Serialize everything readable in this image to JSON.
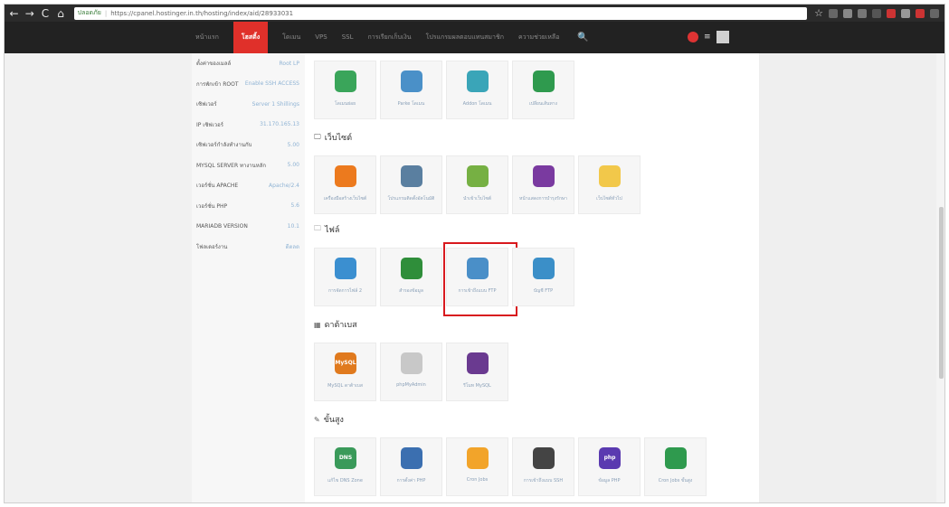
{
  "browser": {
    "back": "←",
    "forward": "→",
    "reload": "C",
    "home": "⌂",
    "lock": "🔒",
    "secure_label": "ปลอดภัย",
    "url": "https://cpanel.hostinger.in.th/hosting/index/aid/28933031",
    "star": "☆"
  },
  "topnav": {
    "items": [
      "หน้าแรก",
      "โฮสติ้ง",
      "โดเมน",
      "VPS",
      "SSL",
      "การเรียกเก็บเงิน",
      "โปรแกรมผลตอบแทนสมาชิก",
      "ความช่วยเหลือ"
    ],
    "active_index": 1,
    "search_icon": "🔍",
    "menu_icon": "≡"
  },
  "sidebar": {
    "items": [
      {
        "label": "ตั้งค่าของเมลล์",
        "value": "Root LP"
      },
      {
        "label": "การพักเข้า ROOT",
        "value": "Enable SSH ACCESS"
      },
      {
        "label": "เซิฟเวอร์",
        "value": "Server 1 Shillings"
      },
      {
        "label": "IP เซิฟเวอร์",
        "value": "31.170.165.13"
      },
      {
        "label": "เซิฟเวอร์กำลังทำงานกับ",
        "value": "5.00"
      },
      {
        "label": "MYSQL SERVER ทางานหลัก",
        "value": "5.00"
      },
      {
        "label": "เวอร์ชั่น APACHE",
        "value": "Apache/2.4"
      },
      {
        "label": "เวอร์ชั่น PHP",
        "value": "5.6"
      },
      {
        "label": "MARIADB VERSION",
        "value": "10.1"
      },
      {
        "label": "โฟลเดอร์งาน",
        "value": "ดีตลด"
      }
    ]
  },
  "sections": {
    "domains": {
      "tiles": [
        {
          "label": "โดเมนย่อย",
          "icon": "subdomain-icon",
          "color": "#3aa55a"
        },
        {
          "label": "Parke โดเมน",
          "icon": "parked-domain-icon",
          "color": "#4a90c8"
        },
        {
          "label": "Addon โดเมน",
          "icon": "addon-domain-icon",
          "color": "#3aa5b8"
        },
        {
          "label": "เปลี่ยนเส้นทาง",
          "icon": "redirect-icon",
          "color": "#2f9a4e"
        }
      ]
    },
    "website": {
      "title": "เว็บไซต์",
      "icon": "🖵",
      "tiles": [
        {
          "label": "เครื่องมือสร้างเว็บไซต์",
          "icon": "website-builder-icon",
          "color": "#ec7a1e"
        },
        {
          "label": "โปรแกรมติดตั้งอัตโนมัติ",
          "icon": "auto-installer-icon",
          "color": "#5a7fa0"
        },
        {
          "label": "นำเข้าเว็บไซต์",
          "icon": "import-website-icon",
          "color": "#76b043"
        },
        {
          "label": "หน้าแสดงการบำรุงรักษา",
          "icon": "error-pages-icon",
          "color": "#7a3aa0"
        },
        {
          "label": "เว็บไซต์ทั่วไป",
          "icon": "website-icon",
          "color": "#f2c84a"
        }
      ]
    },
    "files": {
      "title": "ไฟล์",
      "icon": "🗀",
      "tiles": [
        {
          "label": "การจัดการไฟล์ 2",
          "icon": "file-manager-icon",
          "color": "#3b8fd0"
        },
        {
          "label": "สำรองข้อมูล",
          "icon": "backup-icon",
          "color": "#2f8e3a"
        },
        {
          "label": "การเข้าถึงแบบ FTP",
          "icon": "ftp-access-icon",
          "color": "#4a8fc8"
        },
        {
          "label": "บัญชี FTP",
          "icon": "ftp-accounts-icon",
          "color": "#3b8fc8"
        }
      ]
    },
    "databases": {
      "title": "ดาต้าเบส",
      "icon": "▦",
      "tiles": [
        {
          "label": "MySQL ดาต้าเบส",
          "icon": "mysql-databases-icon",
          "color": "#e07a1e",
          "extra": "MySQL"
        },
        {
          "label": "phpMyAdmin",
          "icon": "phpmyadmin-icon",
          "color": "#c8c8c8"
        },
        {
          "label": "รีโมท MySQL",
          "icon": "remote-mysql-icon",
          "color": "#6a3a90"
        }
      ]
    },
    "advanced": {
      "title": "ขั้นสูง",
      "icon": "✎",
      "tiles": [
        {
          "label": "แก้ไข DNS Zone",
          "icon": "dns-zone-icon",
          "color": "#3a9a5a",
          "extra": "DNS"
        },
        {
          "label": "การตั้งค่า PHP",
          "icon": "php-config-icon",
          "color": "#3b6fb0"
        },
        {
          "label": "Cron Jobs",
          "icon": "cron-jobs-icon",
          "color": "#f2a42a"
        },
        {
          "label": "การเข้าถึงแบบ SSH",
          "icon": "ssh-access-icon",
          "color": "#444444"
        },
        {
          "label": "ข้อมูล PHP",
          "icon": "php-info-icon",
          "color": "#5a3ab0",
          "extra": "php"
        },
        {
          "label": "Cron Jobs ขั้นสูง",
          "icon": "advanced-cron-icon",
          "color": "#2f9a4e"
        }
      ]
    }
  },
  "colors": {
    "nav_active": "#e0302a",
    "highlight": "#d8191e"
  }
}
